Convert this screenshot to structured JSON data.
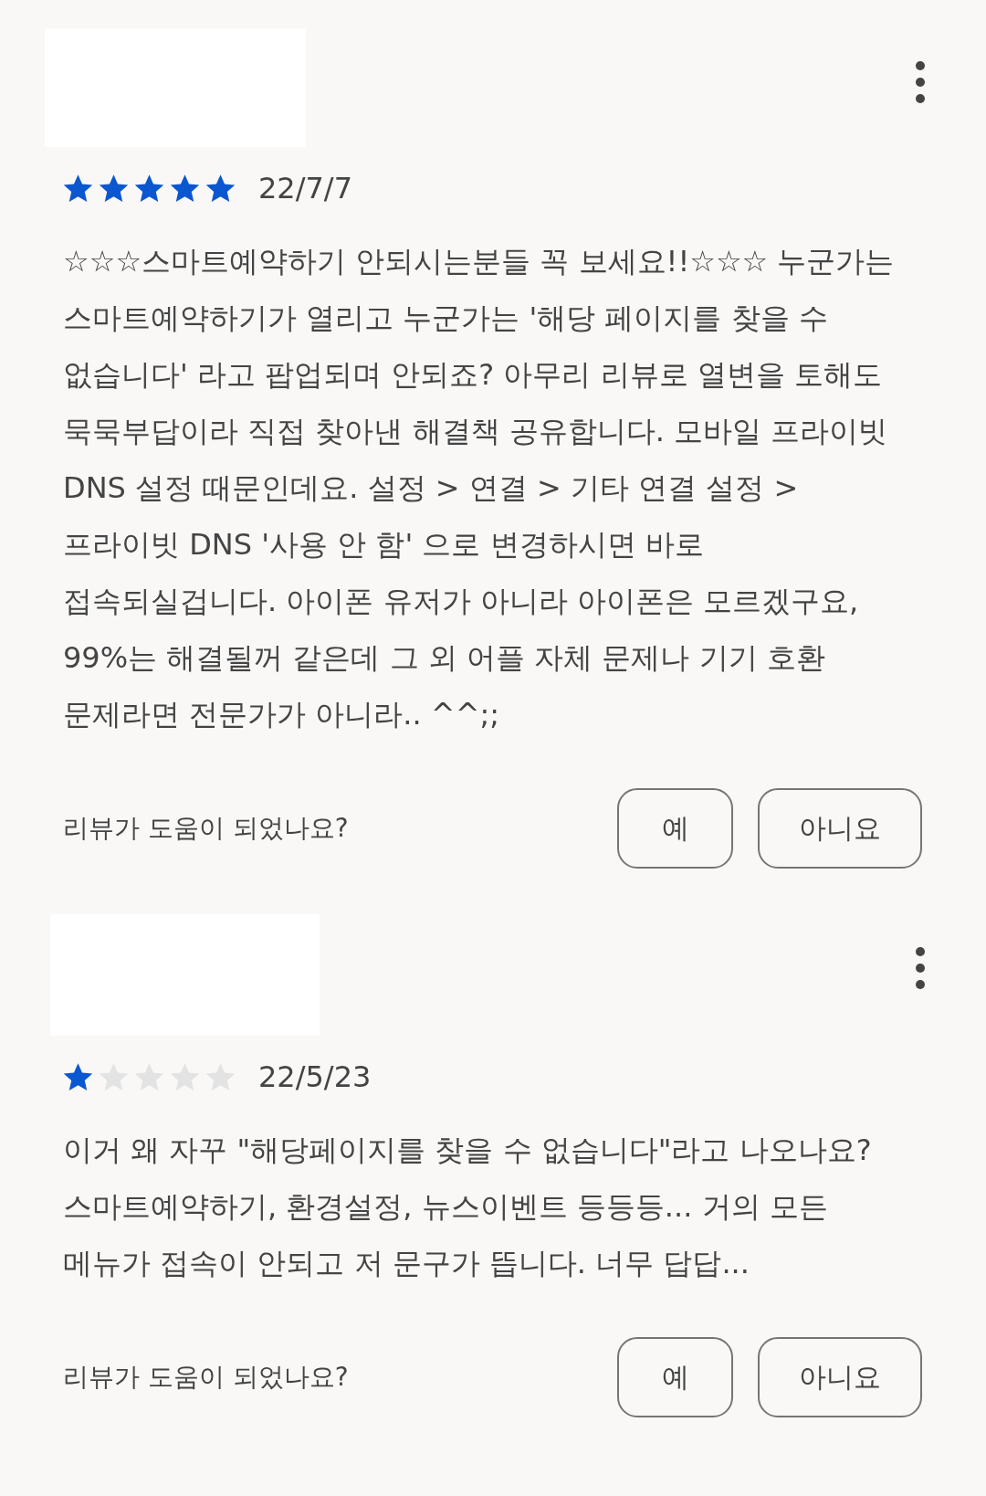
{
  "reviews": [
    {
      "stars": 5,
      "date": "22/7/7",
      "text": "☆☆☆스마트예약하기 안되시는분들 꼭 보세요!!☆☆☆ 누군가는 스마트예약하기가 열리고 누군가는 '해당 페이지를 찾을 수 없습니다' 라고 팝업되며 안되죠? 아무리 리뷰로 열변을 토해도 묵묵부답이라 직접 찾아낸 해결책 공유합니다. 모바일 프라이빗 DNS 설정 때문인데요. 설정 > 연결 > 기타 연결 설정 > 프라이빗 DNS '사용 안 함' 으로 변경하시면 바로 접속되실겁니다. 아이폰 유저가 아니라 아이폰은 모르겠구요, 99%는 해결될꺼 같은데 그 외 어플 자체 문제나 기기 호환 문제라면 전문가가 아니라.. ^^;;",
      "helpful_prompt": "리뷰가 도움이 되었나요?",
      "buttons": [
        "예",
        "아니요"
      ]
    },
    {
      "stars": 1,
      "date": "22/5/23",
      "text": "이거 왜 자꾸 \"해당페이지를 찾을 수 없습니다\"라고 나오나요? 스마트예약하기, 환경설정, 뉴스이벤트 등등등... 거의 모든 메뉴가 접속이 안되고 저 문구가 뜹니다. 너무 답답...",
      "helpful_prompt": "리뷰가 도움이 되었나요?",
      "buttons": [
        "예",
        "아니요"
      ]
    }
  ]
}
